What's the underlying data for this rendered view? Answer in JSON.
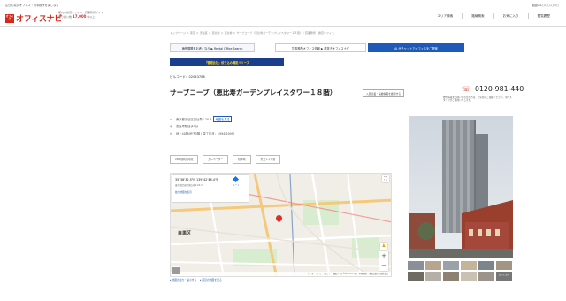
{
  "header": {
    "topnote_line1": "広島の賃貸オフィス・貸事務所を探しなら",
    "topnote_line2": "オフィスナビ",
    "logo_mark": "オフィス",
    "logo_text": "オフィスナビ",
    "tagline_line1": "都内の賃貸オフィス・貸事務所サイト",
    "tagline_line2_prefix": "取り扱い数",
    "tagline_count": "17,000",
    "tagline_line2_suffix": "件以上",
    "phone_top": "電話03-○○○-○○○",
    "nav": [
      "エリア検索",
      "路線検索",
      "お気に入り",
      "閲覧履歴"
    ]
  },
  "breadcrumb": "トップページ ＞ 東京 ＞ 渋谷区 ＞ 恵比寿 ＞ 恵比寿 ＞ サーブコーブ（恵比寿ガーデンプレイスタワー１８階）｜貸事務所・賃貸オフィス",
  "banners": {
    "b1": "海外展開をお考えなら ▶ Rental Office Search",
    "b2": "貸事務所オフィス情報 ▶ 居抜きオフィスナビ",
    "b3": "AI がチャットでオフィスをご提案",
    "b4": "「管理会社」絞り込み機能リリース"
  },
  "building": {
    "code": "ビルコード：02043786",
    "title": "サーブコーブ（恵比寿ガーデンプレイスタワー１８階）",
    "inquiry_button": "入居企業・実績情報を確認する",
    "address": "東京都渋谷区恵比寿4-20-3",
    "address_link": "地図を見る",
    "station": "恵比寿駅徒歩5分",
    "spec": "地上40階/地下5階 | 竣工年月：1994年09月"
  },
  "contact": {
    "tel": "0120-981-440",
    "note": "物件情報をお問い合わせの方は、お気軽にご連絡ください。専門スタッフがご案内いたします。"
  },
  "tags": [
    "24時間利用可能",
    "エレベーター",
    "駐車場",
    "男女トイレ別"
  ],
  "map": {
    "coord": "35°38'32.5\"N 139°42'48.4\"E",
    "address2": "東京都渋谷区恵比寿4-20-3",
    "large_map_link": "拡大地図を表示",
    "route_label": "ルート",
    "ward_label": "目黒区",
    "zoom_in": "+",
    "zoom_out": "−",
    "footer": "キーボードショートカット　地図データ ©2024 Google　利用規約　地図の誤りを報告する"
  },
  "map_links": "▸ 地図の拡大・縮小する　 ▸ 周辺の地図を見る",
  "photo": {
    "more_label": "もっと見る"
  },
  "colors": {
    "brand": "#d7261a",
    "link": "#1e5bb8",
    "accent": "#1a3e8c"
  }
}
